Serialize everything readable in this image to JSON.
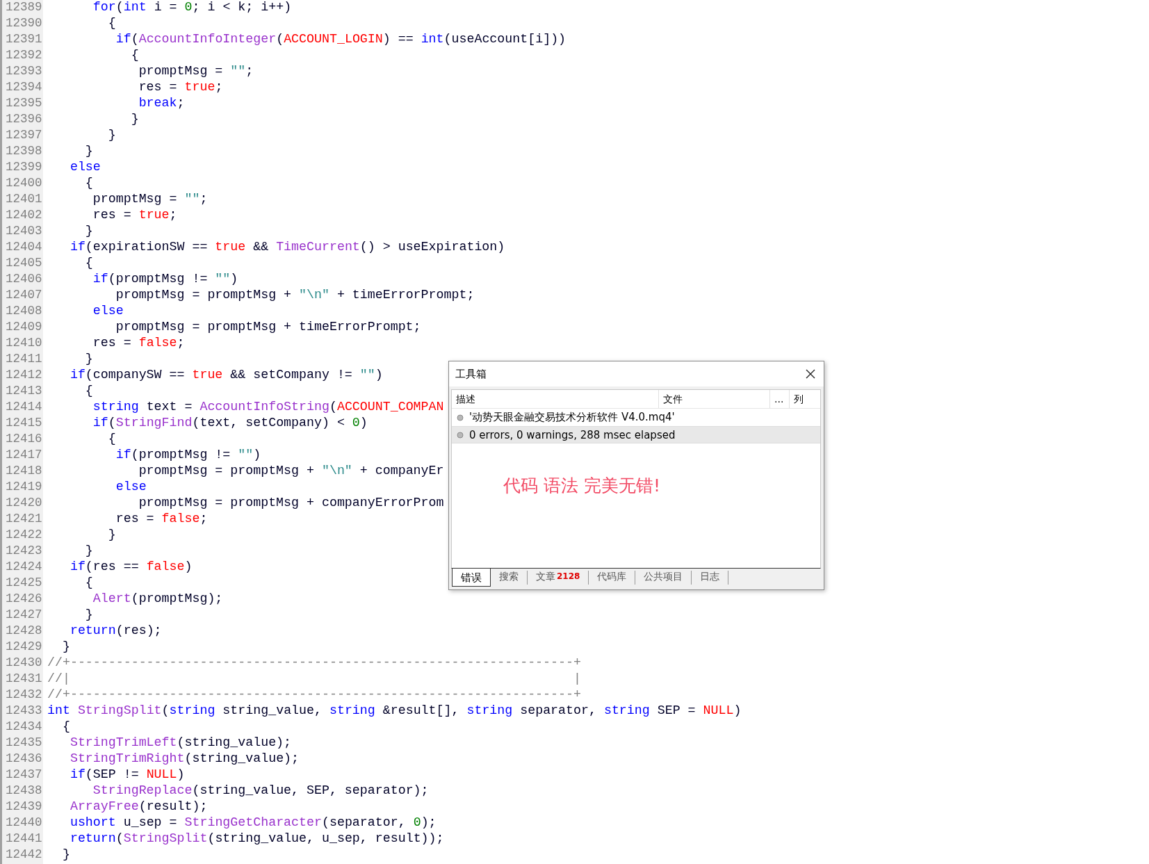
{
  "editor": {
    "lines": [
      {
        "number": "12389",
        "tokens": [
          {
            "kind": "keyword",
            "text": "      for"
          },
          {
            "kind": "plain",
            "text": "("
          },
          {
            "kind": "keyword",
            "text": "int"
          },
          {
            "kind": "plain",
            "text": " i = "
          },
          {
            "kind": "number",
            "text": "0"
          },
          {
            "kind": "plain",
            "text": "; i < k; i++)"
          }
        ]
      },
      {
        "number": "12390",
        "tokens": [
          {
            "kind": "plain",
            "text": "        {"
          }
        ]
      },
      {
        "number": "12391",
        "tokens": [
          {
            "kind": "keyword",
            "text": "         if"
          },
          {
            "kind": "plain",
            "text": "("
          },
          {
            "kind": "function",
            "text": "AccountInfoInteger"
          },
          {
            "kind": "plain",
            "text": "("
          },
          {
            "kind": "constant",
            "text": "ACCOUNT_LOGIN"
          },
          {
            "kind": "plain",
            "text": ") == "
          },
          {
            "kind": "keyword",
            "text": "int"
          },
          {
            "kind": "plain",
            "text": "(useAccount[i]))"
          }
        ]
      },
      {
        "number": "12392",
        "tokens": [
          {
            "kind": "plain",
            "text": "           {"
          }
        ]
      },
      {
        "number": "12393",
        "tokens": [
          {
            "kind": "plain",
            "text": "            promptMsg = "
          },
          {
            "kind": "string",
            "text": "\"\""
          },
          {
            "kind": "plain",
            "text": ";"
          }
        ]
      },
      {
        "number": "12394",
        "tokens": [
          {
            "kind": "plain",
            "text": "            res = "
          },
          {
            "kind": "constant",
            "text": "true"
          },
          {
            "kind": "plain",
            "text": ";"
          }
        ]
      },
      {
        "number": "12395",
        "tokens": [
          {
            "kind": "keyword",
            "text": "            break"
          },
          {
            "kind": "plain",
            "text": ";"
          }
        ]
      },
      {
        "number": "12396",
        "tokens": [
          {
            "kind": "plain",
            "text": "           }"
          }
        ]
      },
      {
        "number": "12397",
        "tokens": [
          {
            "kind": "plain",
            "text": "        }"
          }
        ]
      },
      {
        "number": "12398",
        "tokens": [
          {
            "kind": "plain",
            "text": "     }"
          }
        ]
      },
      {
        "number": "12399",
        "tokens": [
          {
            "kind": "keyword",
            "text": "   else"
          }
        ]
      },
      {
        "number": "12400",
        "tokens": [
          {
            "kind": "plain",
            "text": "     {"
          }
        ]
      },
      {
        "number": "12401",
        "tokens": [
          {
            "kind": "plain",
            "text": "      promptMsg = "
          },
          {
            "kind": "string",
            "text": "\"\""
          },
          {
            "kind": "plain",
            "text": ";"
          }
        ]
      },
      {
        "number": "12402",
        "tokens": [
          {
            "kind": "plain",
            "text": "      res = "
          },
          {
            "kind": "constant",
            "text": "true"
          },
          {
            "kind": "plain",
            "text": ";"
          }
        ]
      },
      {
        "number": "12403",
        "tokens": [
          {
            "kind": "plain",
            "text": "     }"
          }
        ]
      },
      {
        "number": "12404",
        "tokens": [
          {
            "kind": "keyword",
            "text": "   if"
          },
          {
            "kind": "plain",
            "text": "(expirationSW == "
          },
          {
            "kind": "constant",
            "text": "true"
          },
          {
            "kind": "plain",
            "text": " && "
          },
          {
            "kind": "function",
            "text": "TimeCurrent"
          },
          {
            "kind": "plain",
            "text": "() > useExpiration)"
          }
        ]
      },
      {
        "number": "12405",
        "tokens": [
          {
            "kind": "plain",
            "text": "     {"
          }
        ]
      },
      {
        "number": "12406",
        "tokens": [
          {
            "kind": "keyword",
            "text": "      if"
          },
          {
            "kind": "plain",
            "text": "(promptMsg != "
          },
          {
            "kind": "string",
            "text": "\"\""
          },
          {
            "kind": "plain",
            "text": ")"
          }
        ]
      },
      {
        "number": "12407",
        "tokens": [
          {
            "kind": "plain",
            "text": "         promptMsg = promptMsg + "
          },
          {
            "kind": "string",
            "text": "\"\\n\""
          },
          {
            "kind": "plain",
            "text": " + timeErrorPrompt;"
          }
        ]
      },
      {
        "number": "12408",
        "tokens": [
          {
            "kind": "keyword",
            "text": "      else"
          }
        ]
      },
      {
        "number": "12409",
        "tokens": [
          {
            "kind": "plain",
            "text": "         promptMsg = promptMsg + timeErrorPrompt;"
          }
        ]
      },
      {
        "number": "12410",
        "tokens": [
          {
            "kind": "plain",
            "text": "      res = "
          },
          {
            "kind": "constant",
            "text": "false"
          },
          {
            "kind": "plain",
            "text": ";"
          }
        ]
      },
      {
        "number": "12411",
        "tokens": [
          {
            "kind": "plain",
            "text": "     }"
          }
        ]
      },
      {
        "number": "12412",
        "tokens": [
          {
            "kind": "keyword",
            "text": "   if"
          },
          {
            "kind": "plain",
            "text": "(companySW == "
          },
          {
            "kind": "constant",
            "text": "true"
          },
          {
            "kind": "plain",
            "text": " && setCompany != "
          },
          {
            "kind": "string",
            "text": "\"\""
          },
          {
            "kind": "plain",
            "text": ")"
          }
        ]
      },
      {
        "number": "12413",
        "tokens": [
          {
            "kind": "plain",
            "text": "     {"
          }
        ]
      },
      {
        "number": "12414",
        "tokens": [
          {
            "kind": "keyword",
            "text": "      string"
          },
          {
            "kind": "plain",
            "text": " text = "
          },
          {
            "kind": "function",
            "text": "AccountInfoString"
          },
          {
            "kind": "plain",
            "text": "("
          },
          {
            "kind": "constant",
            "text": "ACCOUNT_COMPAN"
          }
        ]
      },
      {
        "number": "12415",
        "tokens": [
          {
            "kind": "keyword",
            "text": "      if"
          },
          {
            "kind": "plain",
            "text": "("
          },
          {
            "kind": "function",
            "text": "StringFind"
          },
          {
            "kind": "plain",
            "text": "(text, setCompany) < "
          },
          {
            "kind": "number",
            "text": "0"
          },
          {
            "kind": "plain",
            "text": ")"
          }
        ]
      },
      {
        "number": "12416",
        "tokens": [
          {
            "kind": "plain",
            "text": "        {"
          }
        ]
      },
      {
        "number": "12417",
        "tokens": [
          {
            "kind": "keyword",
            "text": "         if"
          },
          {
            "kind": "plain",
            "text": "(promptMsg != "
          },
          {
            "kind": "string",
            "text": "\"\""
          },
          {
            "kind": "plain",
            "text": ")"
          }
        ]
      },
      {
        "number": "12418",
        "tokens": [
          {
            "kind": "plain",
            "text": "            promptMsg = promptMsg + "
          },
          {
            "kind": "string",
            "text": "\"\\n\""
          },
          {
            "kind": "plain",
            "text": " + companyEr"
          }
        ]
      },
      {
        "number": "12419",
        "tokens": [
          {
            "kind": "keyword",
            "text": "         else"
          }
        ]
      },
      {
        "number": "12420",
        "tokens": [
          {
            "kind": "plain",
            "text": "            promptMsg = promptMsg + companyErrorProm"
          }
        ]
      },
      {
        "number": "12421",
        "tokens": [
          {
            "kind": "plain",
            "text": "         res = "
          },
          {
            "kind": "constant",
            "text": "false"
          },
          {
            "kind": "plain",
            "text": ";"
          }
        ]
      },
      {
        "number": "12422",
        "tokens": [
          {
            "kind": "plain",
            "text": "        }"
          }
        ]
      },
      {
        "number": "12423",
        "tokens": [
          {
            "kind": "plain",
            "text": "     }"
          }
        ]
      },
      {
        "number": "12424",
        "tokens": [
          {
            "kind": "keyword",
            "text": "   if"
          },
          {
            "kind": "plain",
            "text": "(res == "
          },
          {
            "kind": "constant",
            "text": "false"
          },
          {
            "kind": "plain",
            "text": ")"
          }
        ]
      },
      {
        "number": "12425",
        "tokens": [
          {
            "kind": "plain",
            "text": "     {"
          }
        ]
      },
      {
        "number": "12426",
        "tokens": [
          {
            "kind": "function",
            "text": "      Alert"
          },
          {
            "kind": "plain",
            "text": "(promptMsg);"
          }
        ]
      },
      {
        "number": "12427",
        "tokens": [
          {
            "kind": "plain",
            "text": "     }"
          }
        ]
      },
      {
        "number": "12428",
        "tokens": [
          {
            "kind": "keyword",
            "text": "   return"
          },
          {
            "kind": "plain",
            "text": "(res);"
          }
        ]
      },
      {
        "number": "12429",
        "tokens": [
          {
            "kind": "plain",
            "text": "  }"
          }
        ]
      },
      {
        "number": "12430",
        "tokens": [
          {
            "kind": "comment",
            "text": "//+------------------------------------------------------------------+"
          }
        ]
      },
      {
        "number": "12431",
        "tokens": [
          {
            "kind": "comment",
            "text": "//|                                                                  |"
          }
        ]
      },
      {
        "number": "12432",
        "tokens": [
          {
            "kind": "comment",
            "text": "//+------------------------------------------------------------------+"
          }
        ]
      },
      {
        "number": "12433",
        "tokens": [
          {
            "kind": "keyword",
            "text": "int"
          },
          {
            "kind": "function",
            "text": " StringSplit"
          },
          {
            "kind": "plain",
            "text": "("
          },
          {
            "kind": "keyword",
            "text": "string"
          },
          {
            "kind": "plain",
            "text": " string_value, "
          },
          {
            "kind": "keyword",
            "text": "string"
          },
          {
            "kind": "plain",
            "text": " &result[], "
          },
          {
            "kind": "keyword",
            "text": "string"
          },
          {
            "kind": "plain",
            "text": " separator, "
          },
          {
            "kind": "keyword",
            "text": "string"
          },
          {
            "kind": "plain",
            "text": " SEP = "
          },
          {
            "kind": "constant",
            "text": "NULL"
          },
          {
            "kind": "plain",
            "text": ")"
          }
        ]
      },
      {
        "number": "12434",
        "tokens": [
          {
            "kind": "plain",
            "text": "  {"
          }
        ]
      },
      {
        "number": "12435",
        "tokens": [
          {
            "kind": "function",
            "text": "   StringTrimLeft"
          },
          {
            "kind": "plain",
            "text": "(string_value);"
          }
        ]
      },
      {
        "number": "12436",
        "tokens": [
          {
            "kind": "function",
            "text": "   StringTrimRight"
          },
          {
            "kind": "plain",
            "text": "(string_value);"
          }
        ]
      },
      {
        "number": "12437",
        "tokens": [
          {
            "kind": "keyword",
            "text": "   if"
          },
          {
            "kind": "plain",
            "text": "(SEP != "
          },
          {
            "kind": "constant",
            "text": "NULL"
          },
          {
            "kind": "plain",
            "text": ")"
          }
        ]
      },
      {
        "number": "12438",
        "tokens": [
          {
            "kind": "function",
            "text": "      StringReplace"
          },
          {
            "kind": "plain",
            "text": "(string_value, SEP, separator);"
          }
        ]
      },
      {
        "number": "12439",
        "tokens": [
          {
            "kind": "function",
            "text": "   ArrayFree"
          },
          {
            "kind": "plain",
            "text": "(result);"
          }
        ]
      },
      {
        "number": "12440",
        "tokens": [
          {
            "kind": "keyword",
            "text": "   ushort"
          },
          {
            "kind": "plain",
            "text": " u_sep = "
          },
          {
            "kind": "function",
            "text": "StringGetCharacter"
          },
          {
            "kind": "plain",
            "text": "(separator, "
          },
          {
            "kind": "number",
            "text": "0"
          },
          {
            "kind": "plain",
            "text": ");"
          }
        ]
      },
      {
        "number": "12441",
        "tokens": [
          {
            "kind": "keyword",
            "text": "   return"
          },
          {
            "kind": "plain",
            "text": "("
          },
          {
            "kind": "function",
            "text": "StringSplit"
          },
          {
            "kind": "plain",
            "text": "(string_value, u_sep, result));"
          }
        ]
      },
      {
        "number": "12442",
        "tokens": [
          {
            "kind": "plain",
            "text": "  }"
          }
        ]
      }
    ]
  },
  "toolbox": {
    "title": "工具箱",
    "columns": [
      "描述",
      "文件",
      "...",
      "列"
    ],
    "rows": [
      {
        "text": "'动势天眼金融交易技术分析软件 V4.0.mq4'",
        "selected": false
      },
      {
        "text": "0 errors, 0 warnings, 288 msec elapsed",
        "selected": true
      }
    ],
    "annotation": "代码 语法 完美无错!",
    "tabs": [
      {
        "label": "错误",
        "selected": true
      },
      {
        "label": "搜索",
        "selected": false
      },
      {
        "label": "文章",
        "badge": "2128",
        "selected": false
      },
      {
        "label": "代码库",
        "selected": false
      },
      {
        "label": "公共项目",
        "selected": false
      },
      {
        "label": "日志",
        "selected": false
      }
    ]
  }
}
